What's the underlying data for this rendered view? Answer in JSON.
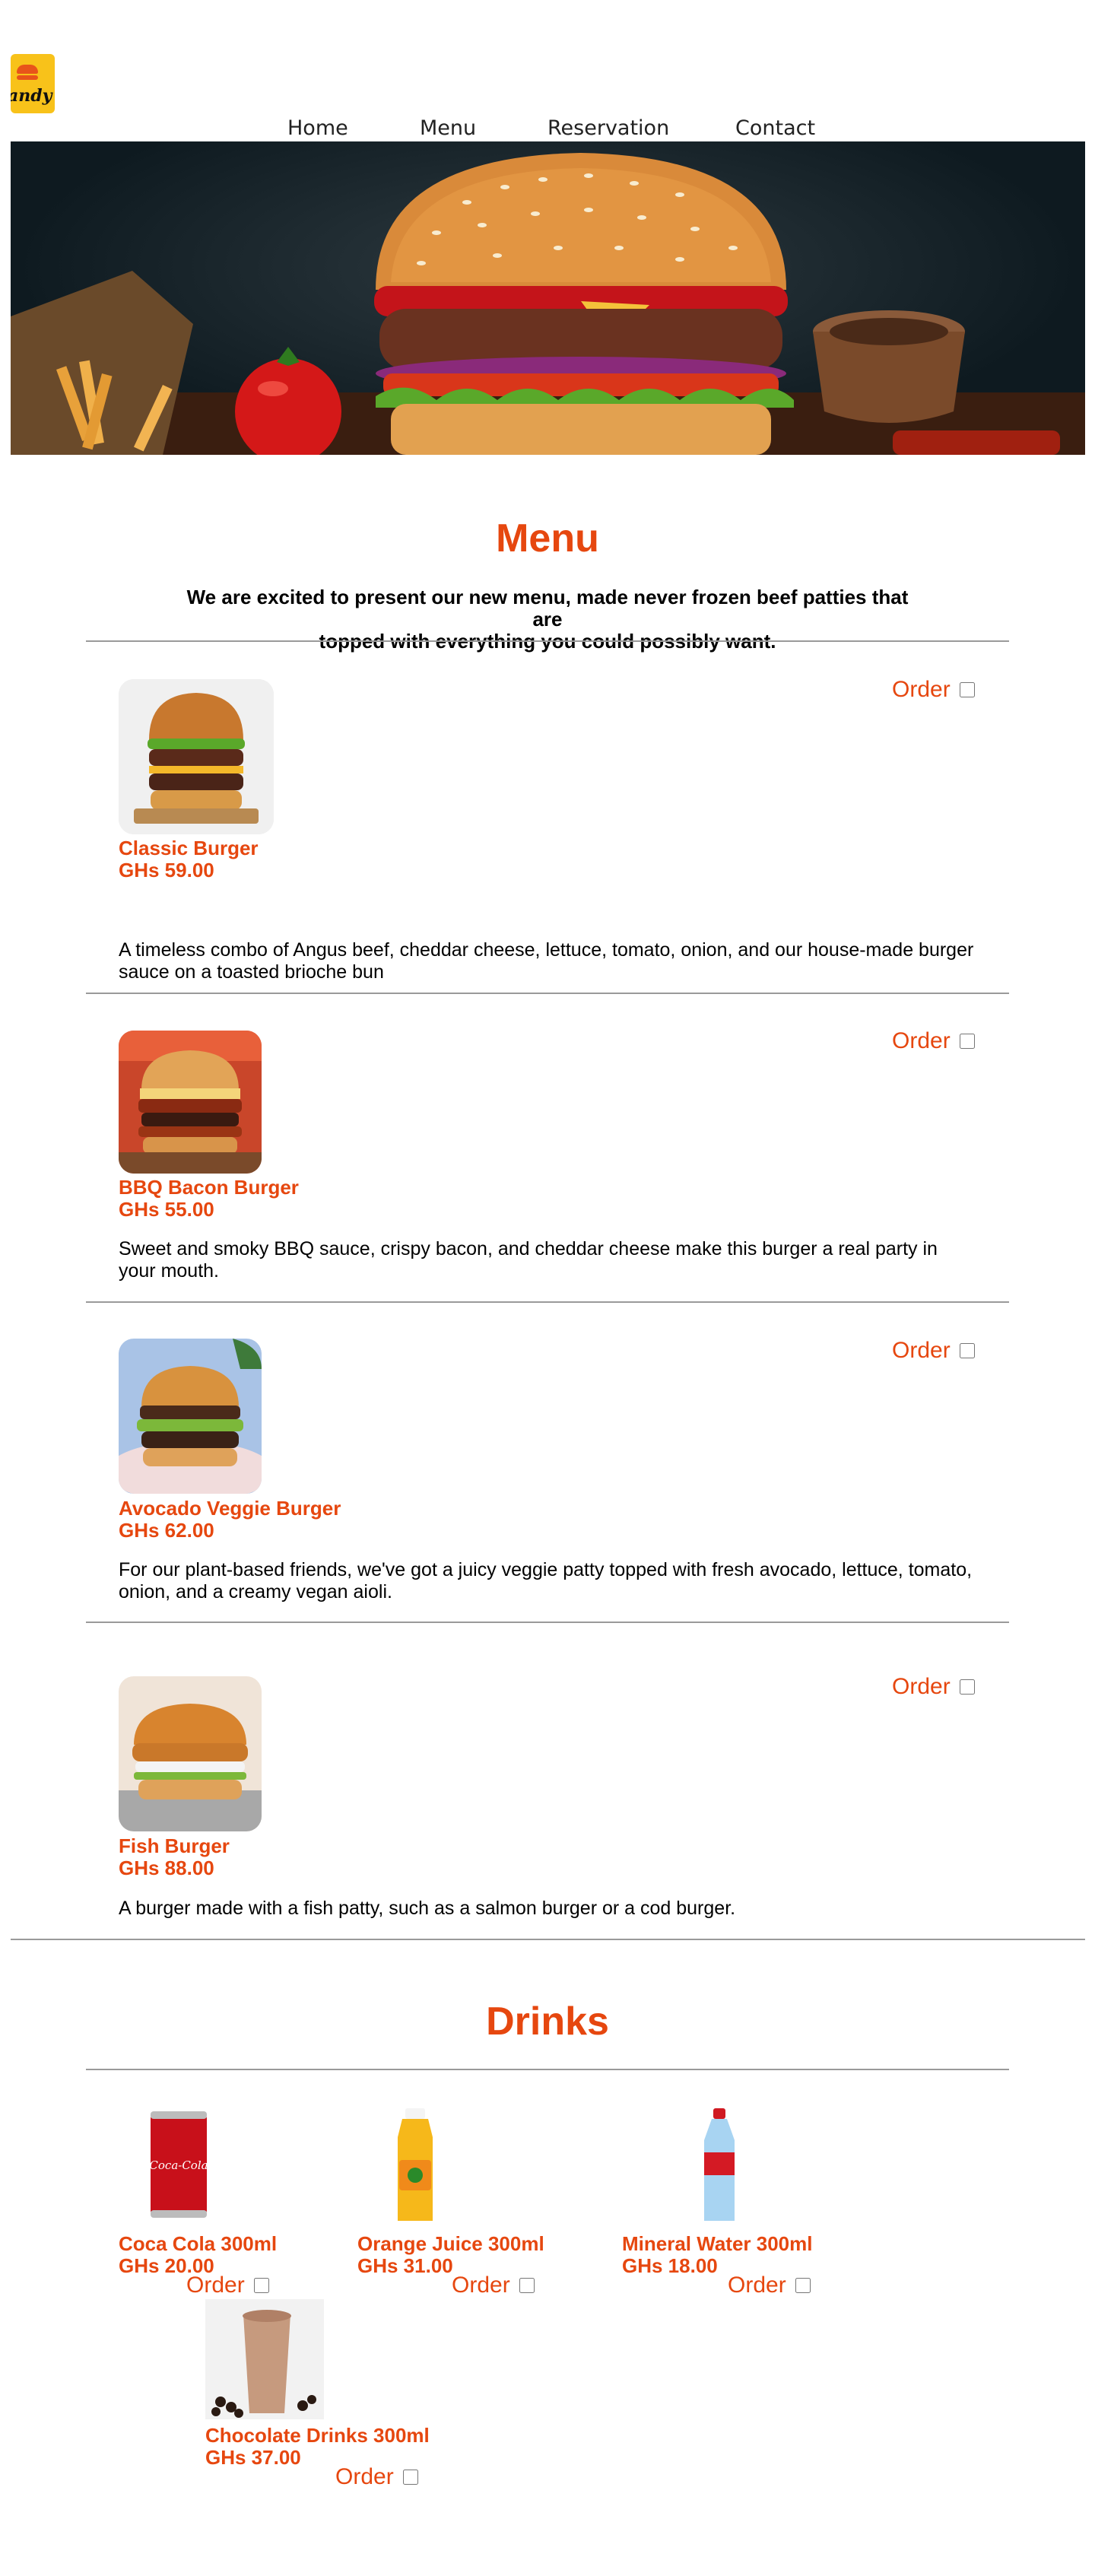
{
  "header": {
    "logo_text": "andy",
    "nav": [
      "Home",
      "Menu",
      "Reservation",
      "Contact"
    ]
  },
  "menu": {
    "title": "Menu",
    "intro_line1": "We are excited to present our new menu, made never frozen beef patties that are",
    "intro_line2": "topped with everything you could possibly want.",
    "order_label": "Order",
    "items": [
      {
        "name": "Classic Burger",
        "price": "GHs 59.00",
        "description_line1": "A timeless combo of Angus beef, cheddar cheese, lettuce, tomato, onion, and our house-made burger",
        "description_line2": "sauce on a toasted brioche bun"
      },
      {
        "name": "BBQ Bacon Burger",
        "price": "GHs 55.00",
        "description_line1": "Sweet and smoky BBQ sauce, crispy bacon, and cheddar cheese make this burger a real party in",
        "description_line2": "your mouth."
      },
      {
        "name": "Avocado Veggie Burger",
        "price": "GHs 62.00",
        "description_line1": "For our plant-based friends, we've got a juicy veggie patty topped with fresh avocado, lettuce, tomato,",
        "description_line2": "onion, and a creamy vegan aioli."
      },
      {
        "name": "Fish Burger",
        "price": "GHs 88.00",
        "description_line1": "A burger made with a fish patty, such as a salmon burger or a cod burger.",
        "description_line2": ""
      }
    ]
  },
  "drinks": {
    "title": "Drinks",
    "order_label": "Order",
    "items": [
      {
        "name": "Coca Cola 300ml",
        "price": "GHs 20.00",
        "logo": "Coca-Cola"
      },
      {
        "name": "Orange Juice 300ml",
        "price": "GHs 31.00"
      },
      {
        "name": "Mineral Water 300ml",
        "price": "GHs 18.00"
      },
      {
        "name": "Chocolate Drinks 300ml",
        "price": "GHs 37.00"
      }
    ]
  },
  "colors": {
    "accent": "#e6470f",
    "logo_bg": "#f8c21a"
  }
}
